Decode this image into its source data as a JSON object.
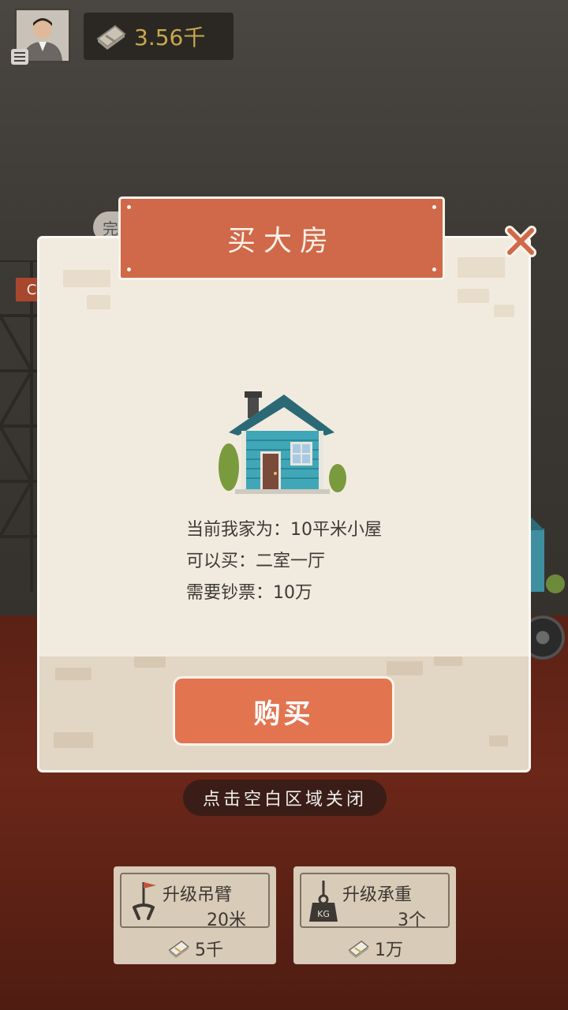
{
  "hud": {
    "money": "3.56千"
  },
  "background": {
    "ghost_chip_text": "完",
    "ghost_tag_text": "C"
  },
  "dialog": {
    "title": "买大房",
    "current_home": "当前我家为：10平米小屋",
    "can_buy": "可以买：二室一厅",
    "cost": "需要钞票：10万",
    "buy_button": "购买"
  },
  "hint": "点击空白区域关闭",
  "upgrades": [
    {
      "title": "升级吊臂",
      "value": "20米",
      "cost": "5千",
      "icon": "crane-hook-icon"
    },
    {
      "title": "升级承重",
      "value": "3个",
      "cost": "1万",
      "icon": "kg-weight-icon"
    }
  ],
  "colors": {
    "accent": "#d0684a",
    "button": "#e27450",
    "money_text": "#c9a94e",
    "dialog_bg": "#f1ebdf"
  }
}
